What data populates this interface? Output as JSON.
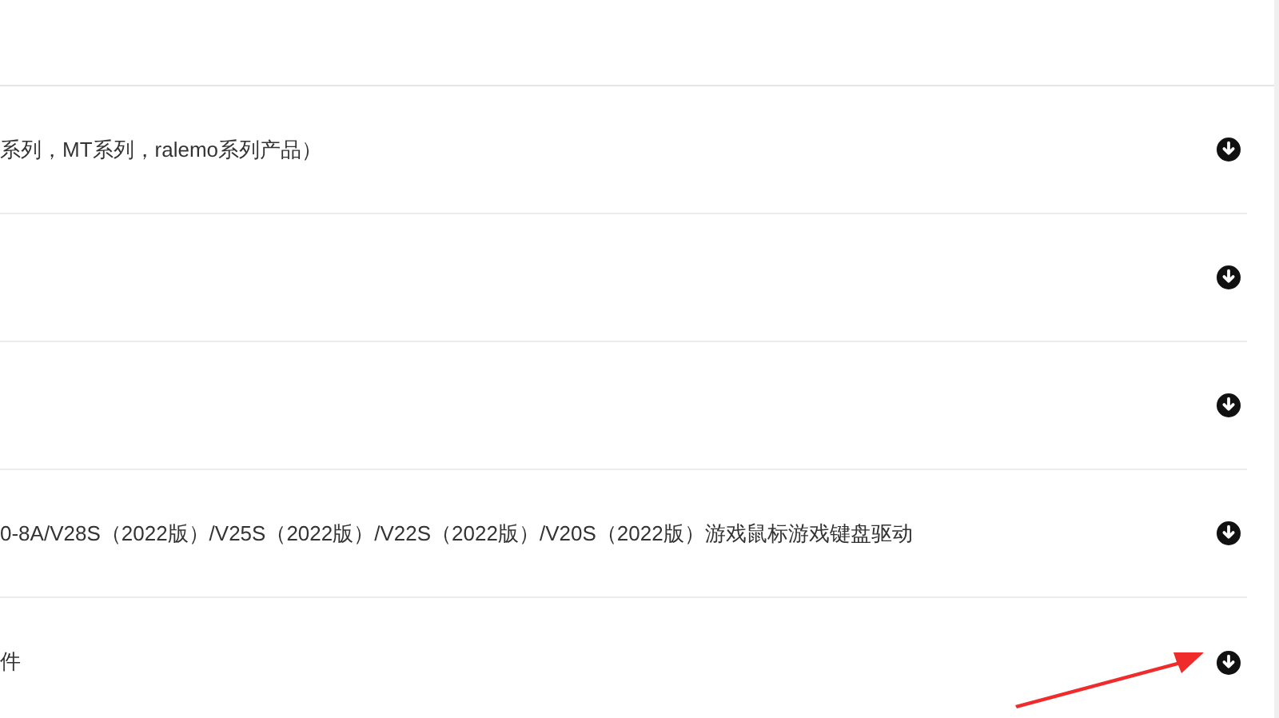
{
  "rows": [
    {
      "title": "系列，MT系列，ralemo系列产品）"
    },
    {},
    {},
    {
      "title": "0-8A/V28S（2022版）/V25S（2022版）/V22S（2022版）/V20S（2022版）游戏鼠标游戏键盘驱动"
    },
    {
      "title": "件"
    }
  ]
}
